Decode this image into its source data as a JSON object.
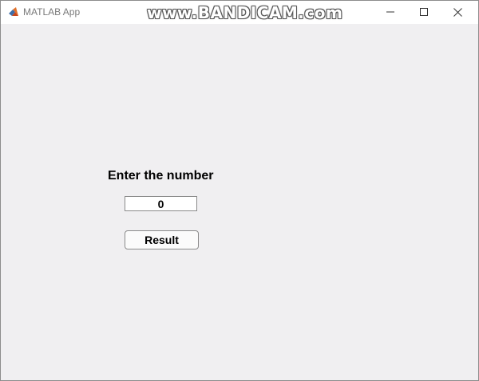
{
  "window": {
    "title": "MATLAB App",
    "watermark": "www.BANDICAM.com",
    "icons": [
      "matlab-icon",
      "minimize-icon",
      "maximize-icon",
      "close-icon"
    ]
  },
  "form": {
    "prompt_label": "Enter the number",
    "number_value": "0",
    "result_label": "Result"
  },
  "colors": {
    "background": "#f0eff1",
    "titlebar": "#ffffff",
    "border": "#8a8a8a"
  }
}
